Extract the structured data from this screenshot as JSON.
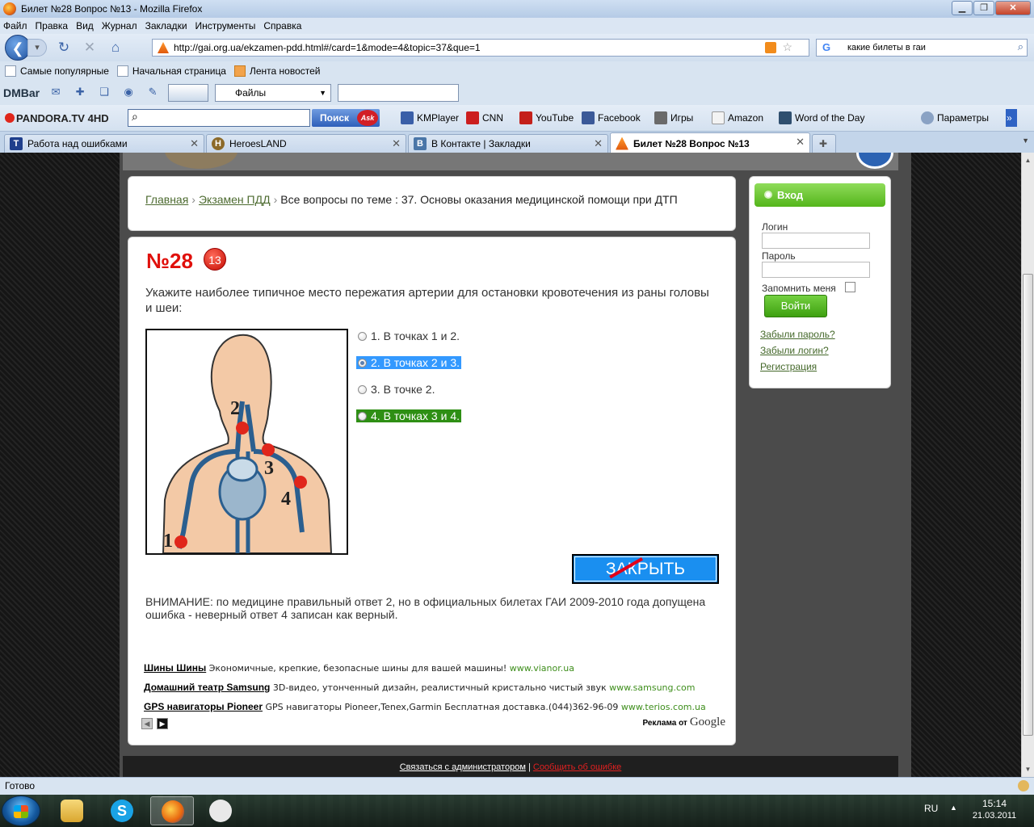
{
  "window": {
    "title": "Билет №28 Вопрос №13 - Mozilla Firefox"
  },
  "menu": [
    "Файл",
    "Правка",
    "Вид",
    "Журнал",
    "Закладки",
    "Инструменты",
    "Справка"
  ],
  "nav": {
    "url": "http://gai.org.ua/ekzamen-pdd.html#/card=1&mode=4&topic=37&que=1",
    "search_value": "какие билеты в гаи"
  },
  "bookmarks": [
    "Самые популярные",
    "Начальная страница",
    "Лента новостей"
  ],
  "dmbar": {
    "logo": "DMBar",
    "files_label": "Файлы"
  },
  "pandora": {
    "logo": "PANDORA.TV",
    "logo_suffix": "4HD",
    "search_button": "Поиск",
    "ask_label": "Ask",
    "items": [
      "KMPlayer",
      "CNN",
      "YouTube",
      "Facebook",
      "Игры",
      "Amazon",
      "Word of the Day",
      "Параметры"
    ]
  },
  "tabs": [
    {
      "label": "Работа над ошибками",
      "favicon": "T"
    },
    {
      "label": "HeroesLAND",
      "favicon": "H"
    },
    {
      "label": "В Контакте | Закладки",
      "favicon": "B"
    },
    {
      "label": "Билет №28 Вопрос №13",
      "favicon": "cone",
      "active": true
    }
  ],
  "page": {
    "breadcrumb": {
      "home": "Главная",
      "exam": "Экзамен ПДД",
      "current": "Все вопросы по теме : 37. Основы оказания медицинской помощи при ДТП"
    },
    "ticket_number": "№28",
    "question_number": "13",
    "question_text": "Укажите наиболее типичное место пережатия артерии для остановки кровотечения из раны головы и шеи:",
    "figure_labels": [
      "1",
      "2",
      "3",
      "4"
    ],
    "answers": [
      {
        "label": "1. В точках 1 и 2.",
        "state": "none"
      },
      {
        "label": "2. В точках 2 и 3.",
        "state": "selected"
      },
      {
        "label": "3. В точке 2.",
        "state": "none"
      },
      {
        "label": "4. В точках 3 и 4.",
        "state": "correct"
      }
    ],
    "close_button": "ЗАКРЫТЬ",
    "notice": "ВНИМАНИЕ: по медицине правильный ответ 2, но в официальных билетах ГАИ 2009-2010 года допущена ошибка - неверный ответ 4 записан как верный."
  },
  "ads": [
    {
      "title": "Шины Шины",
      "text": "Экономичные, крепкие, безопасные шины для вашей машины!",
      "url": "www.vianor.ua"
    },
    {
      "title": "Домашний театр Samsung",
      "text": "3D-видео, утонченный дизайн, реалистичный кристально чистый звук",
      "url": "www.samsung.com"
    },
    {
      "title": "GPS навигаторы Pioneer",
      "text": "GPS навигаторы Pioneer,Tenex,Garmin Бесплатная доставка.(044)362-96-09",
      "url": "www.terios.com.ua"
    }
  ],
  "ads_by": "Реклама от",
  "ads_brand": "Google",
  "login": {
    "title": "Вход",
    "login_label": "Логин",
    "password_label": "Пароль",
    "remember_label": "Запомнить меня",
    "submit": "Войти",
    "forgot_password": "Забыли пароль?",
    "forgot_login": "Забыли логин?",
    "register": "Регистрация"
  },
  "footer": {
    "contact": "Связаться с администратором",
    "separator": "|",
    "report": "Сообщить об ошибке"
  },
  "status": "Готово",
  "taskbar": {
    "lang": "RU",
    "time": "15:14",
    "date": "21.03.2011"
  },
  "colors": {
    "accent_red": "#e0100b",
    "selected_blue": "#3399ff",
    "correct_green": "#2e8f14",
    "login_green": "#54b51b",
    "link_green": "#4d6b30"
  }
}
